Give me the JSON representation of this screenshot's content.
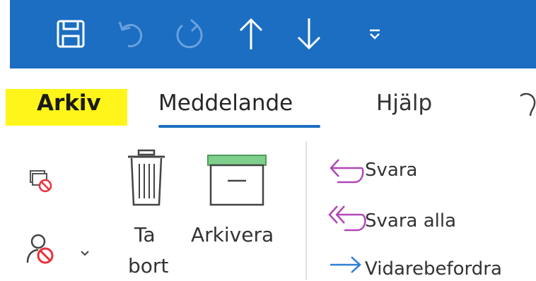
{
  "quick_access": {
    "save_icon": "save-icon",
    "undo_icon": "undo-icon",
    "redo_icon": "redo-icon",
    "up_icon": "arrow-up-icon",
    "down_icon": "arrow-down-icon",
    "customize_icon": "customize-qat-icon"
  },
  "tabs": [
    {
      "label": "Arkiv"
    },
    {
      "label": "Meddelande"
    },
    {
      "label": "Hjälp"
    }
  ],
  "ribbon": {
    "ignore_icon": "ignore-conversation-icon",
    "block_icon": "block-sender-icon",
    "delete": {
      "label_line1": "Ta",
      "label_line2": "bort",
      "icon": "trash-icon"
    },
    "archive": {
      "label": "Arkivera",
      "icon": "archive-box-icon"
    },
    "respond": [
      {
        "label": "Svara",
        "icon": "reply-icon"
      },
      {
        "label": "Svara alla",
        "icon": "reply-all-icon"
      },
      {
        "label": "Vidarebefordra",
        "icon": "forward-icon"
      }
    ]
  },
  "colors": {
    "title_bar": "#1b6ec2",
    "highlight": "#fff51a",
    "reply_purple": "#b147b8",
    "forward_blue": "#2e7fd4",
    "archive_green": "#7fcf8c",
    "block_red": "#e8313a"
  }
}
